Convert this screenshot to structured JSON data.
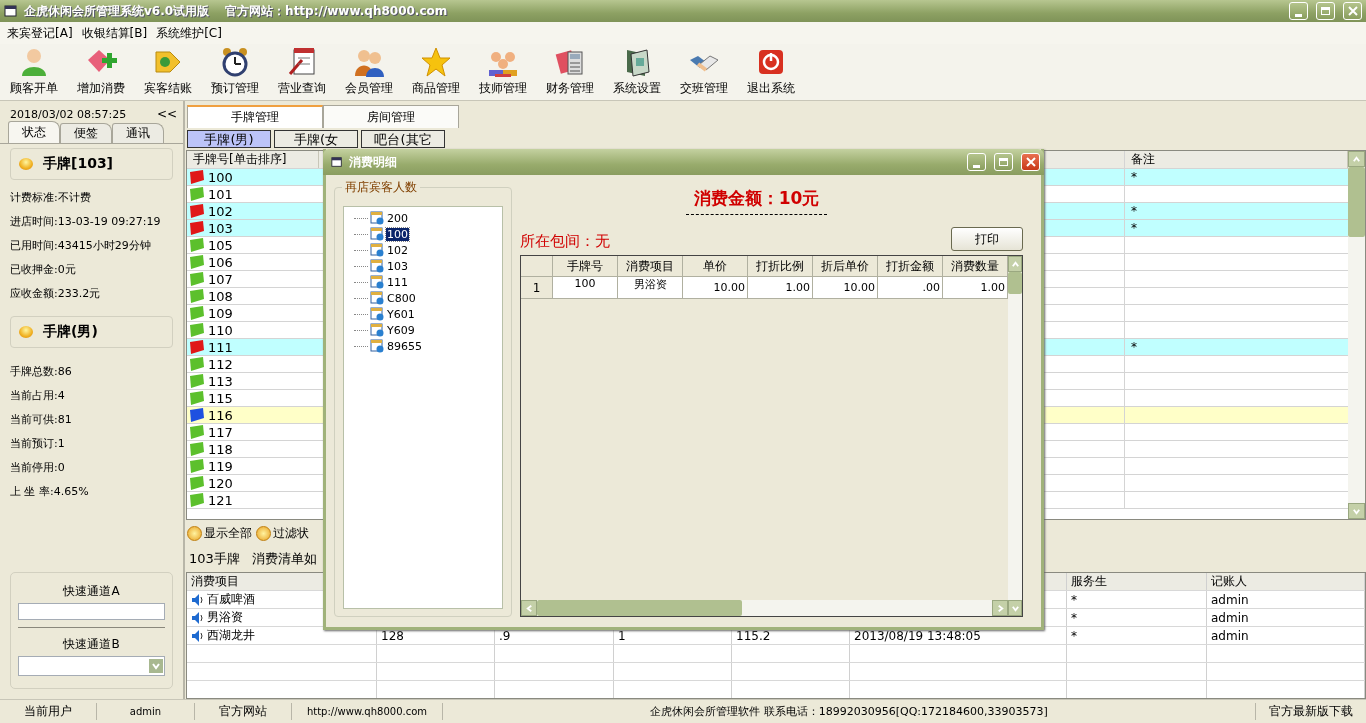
{
  "window": {
    "title": "企虎休闲会所管理系统v6.0试用版",
    "website": "官方网站：http://www.qh8000.com"
  },
  "menu": [
    "来宾登记[A]",
    "收银结算[B]",
    "系统维护[C]"
  ],
  "toolbar": [
    "顾客开单",
    "增加消费",
    "宾客结账",
    "预订管理",
    "营业查询",
    "会员管理",
    "商品管理",
    "技师管理",
    "财务管理",
    "系统设置",
    "交班管理",
    "退出系统"
  ],
  "left_panel": {
    "datetime": "2018/03/02 08:57:25",
    "collapse": "<<",
    "tabs": [
      {
        "label": "状态",
        "selected": true
      },
      {
        "label": "便签",
        "selected": false
      },
      {
        "label": "通讯",
        "selected": false
      }
    ],
    "card_title": "手牌[103]",
    "card_info": [
      {
        "label": "计费标准:",
        "value": "不计费"
      },
      {
        "label": "进店时间:",
        "value": "13-03-19 09:27:19"
      },
      {
        "label": "已用时间:",
        "value": "43415小时29分钟"
      },
      {
        "label": "已收押金:",
        "value": "0元"
      },
      {
        "label": "应收金额:",
        "value": "233.2元"
      }
    ],
    "group_title": "手牌(男)",
    "stats": [
      {
        "label": "手牌总数:",
        "value": "86"
      },
      {
        "label": "当前占用:",
        "value": "4"
      },
      {
        "label": "当前可供:",
        "value": "81"
      },
      {
        "label": "当前预订:",
        "value": "1"
      },
      {
        "label": "当前停用:",
        "value": "0"
      },
      {
        "label": "上 坐 率:",
        "value": "4.65%"
      }
    ],
    "quick_a": "快速通道A",
    "quick_b": "快速通道B"
  },
  "tabs": [
    {
      "label": "手牌管理",
      "selected": true
    },
    {
      "label": "房间管理",
      "selected": false
    }
  ],
  "subtabs": [
    {
      "label": "手牌(男)",
      "selected": true
    },
    {
      "label": "手牌(女",
      "selected": false
    },
    {
      "label": "吧台(其它",
      "selected": false
    }
  ],
  "tag_grid": {
    "columns": [
      "手牌号[单击排序]",
      "备注"
    ],
    "rows": [
      {
        "number": "100",
        "color": "#e01818",
        "occupied": true,
        "reserved": false,
        "note": "*"
      },
      {
        "number": "101",
        "color": "#5cc02c",
        "occupied": false,
        "reserved": false,
        "note": ""
      },
      {
        "number": "102",
        "color": "#e01818",
        "occupied": true,
        "reserved": false,
        "note": "*"
      },
      {
        "number": "103",
        "color": "#e01818",
        "occupied": true,
        "reserved": false,
        "note": "*"
      },
      {
        "number": "105",
        "color": "#5cc02c",
        "occupied": false,
        "reserved": false,
        "note": ""
      },
      {
        "number": "106",
        "color": "#5cc02c",
        "occupied": false,
        "reserved": false,
        "note": ""
      },
      {
        "number": "107",
        "color": "#5cc02c",
        "occupied": false,
        "reserved": false,
        "note": ""
      },
      {
        "number": "108",
        "color": "#5cc02c",
        "occupied": false,
        "reserved": false,
        "note": ""
      },
      {
        "number": "109",
        "color": "#5cc02c",
        "occupied": false,
        "reserved": false,
        "note": ""
      },
      {
        "number": "110",
        "color": "#5cc02c",
        "occupied": false,
        "reserved": false,
        "note": ""
      },
      {
        "number": "111",
        "color": "#e01818",
        "occupied": true,
        "reserved": false,
        "note": "*"
      },
      {
        "number": "112",
        "color": "#5cc02c",
        "occupied": false,
        "reserved": false,
        "note": ""
      },
      {
        "number": "113",
        "color": "#5cc02c",
        "occupied": false,
        "reserved": false,
        "note": ""
      },
      {
        "number": "115",
        "color": "#5cc02c",
        "occupied": false,
        "reserved": false,
        "note": ""
      },
      {
        "number": "116",
        "color": "#1e50e0",
        "occupied": false,
        "reserved": true,
        "note": ""
      },
      {
        "number": "117",
        "color": "#5cc02c",
        "occupied": false,
        "reserved": false,
        "note": ""
      },
      {
        "number": "118",
        "color": "#5cc02c",
        "occupied": false,
        "reserved": false,
        "note": ""
      },
      {
        "number": "119",
        "color": "#5cc02c",
        "occupied": false,
        "reserved": false,
        "note": ""
      },
      {
        "number": "120",
        "color": "#5cc02c",
        "occupied": false,
        "reserved": false,
        "note": ""
      },
      {
        "number": "121",
        "color": "#5cc02c",
        "occupied": false,
        "reserved": false,
        "note": ""
      }
    ]
  },
  "filters": [
    "显示全部",
    "过滤状"
  ],
  "detail_caption": "103手牌",
  "detail_caption_2": "消费清单如",
  "consumption": {
    "columns": [
      "消费项目",
      "服务生",
      "记账人"
    ],
    "rows": [
      {
        "item": "百威啤酒",
        "values": [],
        "waiter": "*",
        "clerk": "admin"
      },
      {
        "item": "男浴资",
        "values": [],
        "waiter": "*",
        "clerk": "admin"
      },
      {
        "item": "西湖龙井",
        "values": [
          "128",
          ".9",
          "1",
          "115.2",
          "2013/08/19 13:48:05"
        ],
        "waiter": "*",
        "clerk": "admin"
      }
    ]
  },
  "dialog": {
    "title": "消费明细",
    "group_label": "再店宾客人数",
    "tree": [
      {
        "label": "200",
        "selected": false
      },
      {
        "label": "100",
        "selected": true
      },
      {
        "label": "102",
        "selected": false
      },
      {
        "label": "103",
        "selected": false
      },
      {
        "label": "111",
        "selected": false
      },
      {
        "label": "C800",
        "selected": false
      },
      {
        "label": "Y601",
        "selected": false
      },
      {
        "label": "Y609",
        "selected": false
      },
      {
        "label": "89655",
        "selected": false
      }
    ],
    "amount": "消费金额：10元",
    "room": "所在包间：无",
    "print": "打印",
    "grid": {
      "columns": [
        "手牌号",
        "消费项目",
        "单价",
        "打折比例",
        "折后单价",
        "打折金额",
        "消费数量"
      ],
      "rows": [
        {
          "index": "1",
          "cells": [
            "100",
            "男浴资",
            "10.00",
            "1.00",
            "10.00",
            ".00",
            "1.00"
          ]
        }
      ]
    }
  },
  "status_bar": [
    "当前用户",
    "admin",
    "官方网站",
    "http://www.qh8000.com",
    "企虎休闲会所管理软件  联系电话：18992030956[QQ:172184600,33903573]",
    "官方最新版下载"
  ]
}
